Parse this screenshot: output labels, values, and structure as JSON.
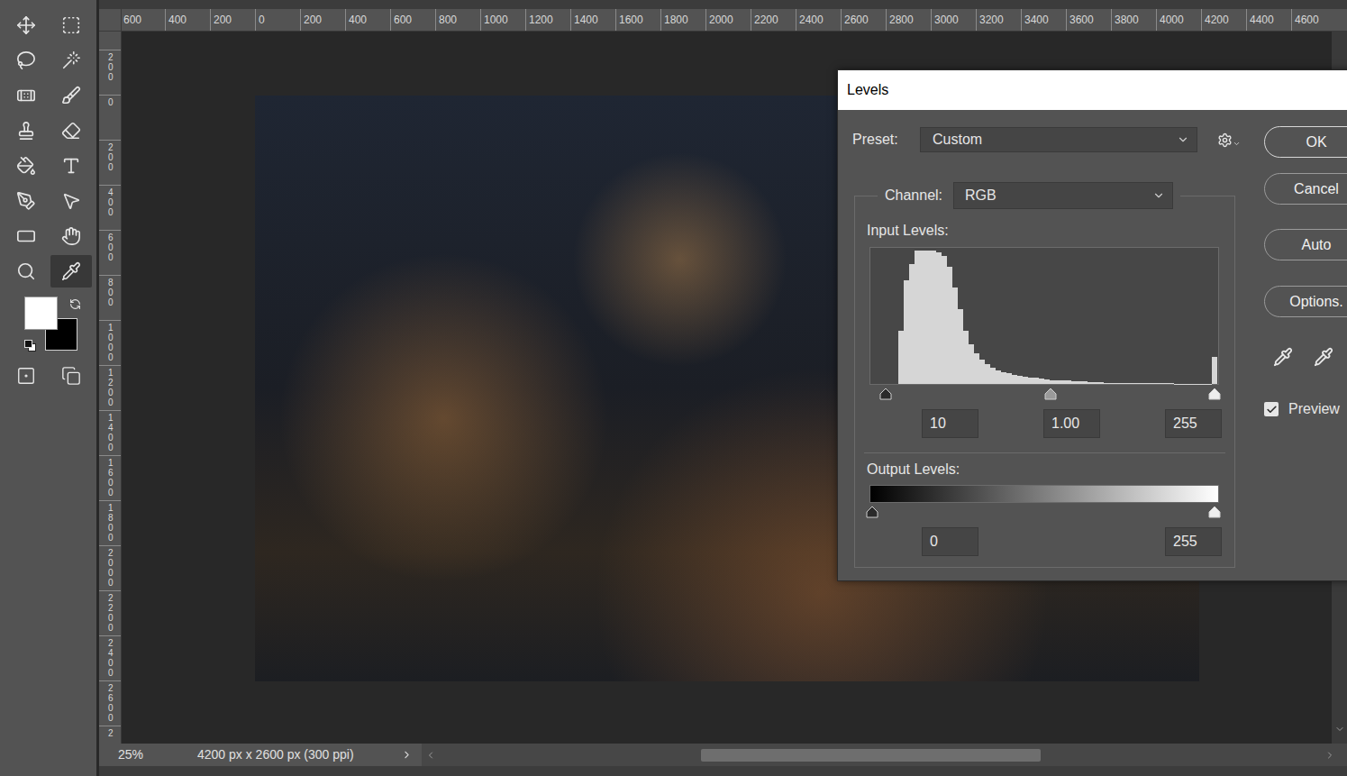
{
  "tools": [
    {
      "selected": false
    },
    {
      "selected": false
    },
    {
      "selected": false
    },
    {
      "selected": false
    },
    {
      "selected": false
    },
    {
      "selected": false
    },
    {
      "selected": false
    },
    {
      "selected": false
    },
    {
      "selected": false
    },
    {
      "selected": false
    },
    {
      "selected": false
    },
    {
      "selected": false
    },
    {
      "selected": false
    },
    {
      "selected": false
    },
    {
      "selected": false
    },
    {
      "selected": true
    }
  ],
  "swatches": {
    "foreground": "#ffffff",
    "background": "#000000"
  },
  "rulers": {
    "horizontal": [
      "600",
      "400",
      "200",
      "0",
      "200",
      "400",
      "600",
      "800",
      "1000",
      "1200",
      "1400",
      "1600",
      "1800",
      "2000",
      "2200",
      "2400",
      "2600",
      "2800",
      "3000",
      "3200",
      "3400",
      "3600",
      "3800",
      "4000",
      "4200",
      "4400",
      "4600"
    ],
    "vertical": [
      "200",
      "0",
      "200",
      "400",
      "600",
      "800",
      "1000",
      "1200",
      "1400",
      "1600",
      "1800",
      "2000",
      "2200",
      "2400",
      "2600",
      "2"
    ]
  },
  "status_bar": {
    "zoom": "25%",
    "document": "4200 px x 2600 px (300 ppi)"
  },
  "dialog": {
    "title": "Levels",
    "preset": {
      "label": "Preset:",
      "value": "Custom"
    },
    "channel": {
      "label": "Channel:",
      "value": "RGB"
    },
    "input_levels": {
      "label": "Input Levels:",
      "histogram": [
        0,
        0,
        0,
        0,
        0,
        40,
        78,
        90,
        100,
        100,
        100,
        100,
        99,
        96,
        88,
        72,
        56,
        40,
        30,
        23,
        18,
        15,
        12,
        10,
        9,
        8,
        7,
        6,
        5.5,
        5,
        4.5,
        4,
        3.5,
        3,
        3,
        2.5,
        2.5,
        2,
        2,
        2,
        1.5,
        1.5,
        1.2,
        1,
        1,
        1,
        0.8,
        0.8,
        0.6,
        0.6,
        0.5,
        0.5,
        0.5,
        0.4,
        0.4,
        0.4,
        0.3,
        0.3,
        0.3,
        0.3,
        0.3,
        0.3,
        0.3,
        20
      ],
      "sliders": [
        {
          "value": "10",
          "level": 0.042,
          "color": "#2b2b2b"
        },
        {
          "value": "1.00",
          "level": 0.522,
          "color": "#9a9a9a"
        },
        {
          "value": "255",
          "level": 1,
          "color": "#eeeeee"
        }
      ]
    },
    "output_levels": {
      "label": "Output Levels:",
      "sliders": [
        {
          "value": "0",
          "level": 0,
          "color": "#2b2b2b"
        },
        {
          "value": "255",
          "level": 1,
          "color": "#eeeeee"
        }
      ]
    },
    "buttons": [
      "OK",
      "Cancel",
      "Auto",
      "Options."
    ],
    "preview": {
      "label": "Preview",
      "checked": true
    }
  }
}
